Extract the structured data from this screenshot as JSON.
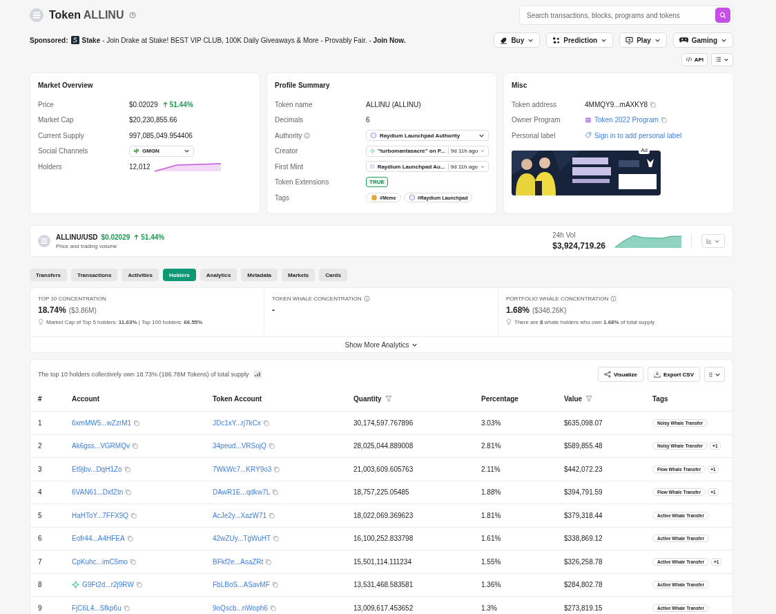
{
  "header": {
    "title": "Token",
    "symbol": "ALLINU",
    "search": {
      "placeholder": "Search transactions, blocks, programs and tokens"
    }
  },
  "sponsored": {
    "label": "Sponsored:",
    "text": "**Stake** - Join Drake at Stake! BEST VIP CLUB, 100K Daily Giveaways & More - Provably Fair. - **Join Now.**"
  },
  "nav_buttons": [
    {
      "label": "Buy",
      "kind": "buy"
    },
    {
      "label": "Prediction",
      "kind": "prediction"
    },
    {
      "label": "Play",
      "kind": "play"
    },
    {
      "label": "Gaming",
      "kind": "gaming"
    }
  ],
  "api_button": "API",
  "market_overview": {
    "title": "Market Overview",
    "rows": [
      {
        "label": "Price",
        "kind": "price",
        "value": "$0.02029",
        "change": "51.44%"
      },
      {
        "label": "Market Cap",
        "kind": "text",
        "value": "$20,230,855.66"
      },
      {
        "label": "Current Supply",
        "kind": "text",
        "value": "997,085,049.954406"
      },
      {
        "label": "Social Channels",
        "kind": "select",
        "value": "GMGN"
      },
      {
        "label": "Holders",
        "kind": "sparkline",
        "value": "12,012"
      }
    ]
  },
  "profile_summary": {
    "title": "Profile Summary",
    "rows": [
      {
        "label": "Token name",
        "kind": "text",
        "value": "ALLINU (ALLINU)"
      },
      {
        "label": "Decimals",
        "kind": "text",
        "value": "6"
      },
      {
        "label": "Authority",
        "kind": "select",
        "info": true,
        "value": "Raydium Launchpad Authority"
      },
      {
        "label": "Creator",
        "kind": "select",
        "info": false,
        "value": "\"turbomantasacre\" on P...",
        "time": "9d 11h ago"
      },
      {
        "label": "First Mint",
        "kind": "select",
        "info": false,
        "value": "Raydium Launchpad Au...",
        "time": "9d 11h ago"
      },
      {
        "label": "Token Extensions",
        "kind": "badge",
        "value": "TRUE"
      },
      {
        "label": "Tags",
        "kind": "tags",
        "tags": [
          {
            "label": "#Meme"
          },
          {
            "label": "#Raydium Launchpad"
          }
        ]
      }
    ]
  },
  "misc": {
    "title": "Misc",
    "rows": [
      {
        "label": "Token address",
        "kind": "copy",
        "value": "4MMQY9...mAXKY8"
      },
      {
        "label": "Owner Program",
        "kind": "program",
        "value": "Token 2022 Program"
      },
      {
        "label": "Personal label",
        "kind": "signin",
        "value": "Sign in to add personal label"
      }
    ],
    "ad": {
      "label": "Ad",
      "kind": "picture"
    }
  },
  "pair": {
    "name": "ALLINU/USD",
    "price": "$0.02029",
    "change": "51.44%",
    "subtitle": "Price and trading volume",
    "vol_label": "24h Vol",
    "vol": "$3,924,719.26"
  },
  "tabs": [
    {
      "label": "Transfers",
      "selected": false
    },
    {
      "label": "Transactions",
      "selected": false
    },
    {
      "label": "Activities",
      "selected": false
    },
    {
      "label": "Holders",
      "selected": true
    },
    {
      "label": "Analytics",
      "selected": false
    },
    {
      "label": "Metadata",
      "selected": false
    },
    {
      "label": "Markets",
      "selected": false
    },
    {
      "label": "Cards",
      "selected": false
    }
  ],
  "analytics": {
    "stats": [
      {
        "label": "TOP 10 CONCENTRATION",
        "info": false,
        "value": "18.74%",
        "sub": "($3.86M)",
        "note": "Market Cap of Top 5 holders: **11.63%** | Top 100 holders: **66.55%**"
      },
      {
        "label": "TOKEN WHALE CONCENTRATION",
        "info": true,
        "value": "-"
      },
      {
        "label": "PORTFOLIO WHALE CONCENTRATION",
        "info": true,
        "value": "1.68%",
        "sub": "($348.26K)",
        "note": "There are **8** whale holders who own **1.68%** of total supply"
      }
    ],
    "more": "Show More Analytics"
  },
  "holders": {
    "summary": "The top 10 holders collectively own 18.73% (186.78M Tokens) of total supply",
    "buttons": [
      {
        "label": "Visualize",
        "kind": "share"
      },
      {
        "label": "Export CSV",
        "kind": "export"
      }
    ],
    "columns": [
      {
        "label": "#",
        "filter": false
      },
      {
        "label": "Account",
        "filter": false
      },
      {
        "label": "Token Account",
        "filter": false
      },
      {
        "label": "Quantity",
        "filter": true
      },
      {
        "label": "Percentage",
        "filter": false
      },
      {
        "label": "Value",
        "filter": true
      },
      {
        "label": "Tags",
        "filter": false
      }
    ],
    "rows": [
      {
        "rank": "1",
        "account": "6xmMW5...wZzrM1",
        "marked": false,
        "token_account": "JDc1xY...rj7kCx",
        "quantity": "30,174,597.767896",
        "percentage": "3.03%",
        "value": "$635,098.07",
        "tag": "Noisy Whale Transfer"
      },
      {
        "rank": "2",
        "account": "Ak6gss...VGRMQv",
        "marked": false,
        "token_account": "34peud...VRSojQ",
        "quantity": "28,025,044.889008",
        "percentage": "2.81%",
        "value": "$589,855.48",
        "tag": "Noisy Whale Transfer",
        "more": "+1"
      },
      {
        "rank": "3",
        "account": "Et9jbv...DqH1Zo",
        "marked": false,
        "token_account": "7WkWc7...KRY9o3",
        "quantity": "21,003,609.605763",
        "percentage": "2.11%",
        "value": "$442,072.23",
        "tag": "Flow Whale Transfer",
        "more": "+1"
      },
      {
        "rank": "4",
        "account": "6VAN61...DxfZtn",
        "marked": false,
        "token_account": "DAwR1E...qdkw7L",
        "quantity": "18,757,225.05485",
        "percentage": "1.88%",
        "value": "$394,791.59",
        "tag": "Flow Whale Transfer",
        "more": "+1"
      },
      {
        "rank": "5",
        "account": "HaHToY...7FFX9Q",
        "marked": false,
        "token_account": "AcJe2y...XazW71",
        "quantity": "18,022,069.369623",
        "percentage": "1.81%",
        "value": "$379,318.44",
        "tag": "Active Whale Transfer"
      },
      {
        "rank": "6",
        "account": "Eofr44...A4HFEA",
        "marked": false,
        "token_account": "42wZUy...TgWuHT",
        "quantity": "16,100,252.833798",
        "percentage": "1.61%",
        "value": "$338,869.12",
        "tag": "Active Whale Transfer"
      },
      {
        "rank": "7",
        "account": "CpKuhc...imC5mo",
        "marked": false,
        "token_account": "BFkf2e...AsaZRt",
        "quantity": "15,501,114.111234",
        "percentage": "1.55%",
        "value": "$326,258.78",
        "tag": "Active Whale Transfer",
        "more": "+1"
      },
      {
        "rank": "8",
        "account": "G9Ft2d...r2j9RW",
        "marked": true,
        "token_account": "FbLBoS...ASavMF",
        "quantity": "13,531,468.583581",
        "percentage": "1.36%",
        "value": "$284,802.78",
        "tag": "Active Whale Transfer"
      },
      {
        "rank": "9",
        "account": "FjC6L4...Sfkp6u",
        "marked": false,
        "token_account": "9oQscb...nWoph6",
        "quantity": "13,009,617.453652",
        "percentage": "1.3%",
        "value": "$273,819.15",
        "tag": "Active Whale Transfer"
      }
    ]
  }
}
